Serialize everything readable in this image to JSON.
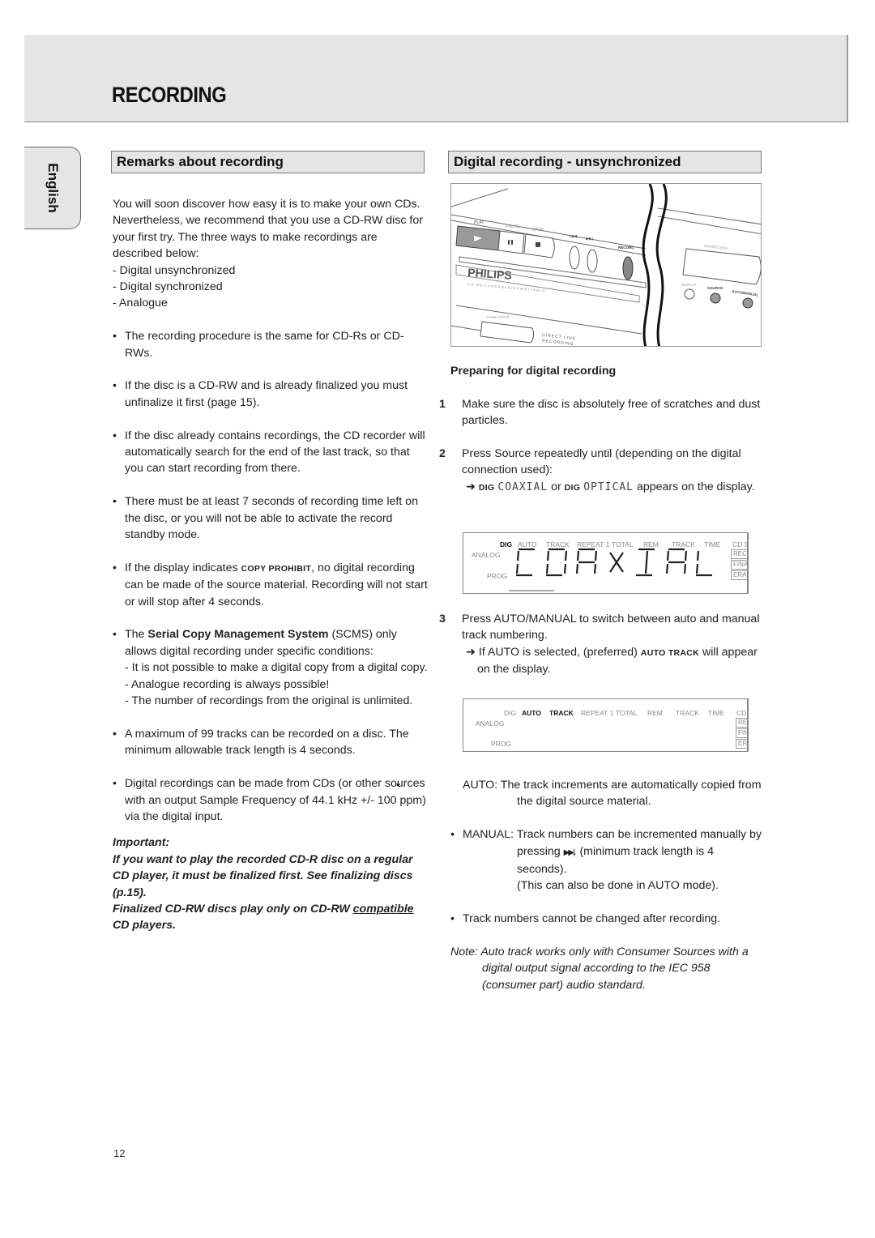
{
  "header": {
    "title": "RECORDING"
  },
  "language_tab": {
    "label": "English"
  },
  "left": {
    "heading": "Remarks about recording",
    "intro": "You will soon discover how easy it is to make your own CDs. Nevertheless, we recommend that you use a CD-RW disc for your first try. The three ways to make recordings are described below:",
    "ways": [
      "- Digital unsynchronized",
      "- Digital synchronized",
      "- Analogue"
    ],
    "bullets": {
      "b1": "The recording procedure is the same for CD-Rs or CD-RWs.",
      "b2": "If the disc is a CD-RW and is already finalized you must unfinalize it first (page 15).",
      "b3": "If the disc already contains recordings, the CD recorder will automatically search for the end of the last track, so that you can start recording from there.",
      "b4": "There must be at least 7 seconds of recording time left on the disc, or you will not be able to activate the record standby mode.",
      "b5_pre": "If the display indicates ",
      "b5_code": "COPY PROHIBIT",
      "b5_post": ", no digital recording can be made of the source material. Recording will not start or will stop after 4 seconds.",
      "b6_pre": "The ",
      "b6_bold": "Serial Copy Management System",
      "b6_post": " (SCMS) only allows digital recording under specific conditions:",
      "b6_subs": [
        "- It is not possible to make a digital copy from a digital copy.",
        "- Analogue recording is always possible!",
        "- The number of recordings from the original is unlimited."
      ],
      "b7": "A maximum of 99 tracks can be recorded on a disc. The minimum allowable track length is 4 seconds.",
      "b8": "Digital recordings can be made from CDs (or other sources with an output Sample Frequency of 44.1 kHz +/- 100 ppm) via the digital input."
    },
    "important": {
      "label": "Important:",
      "text1": "If you want to play the recorded CD-R disc on a regular CD player, it must be finalized first. See finalizing discs (p.15).",
      "text2_pre": "Finalized CD-RW discs play only on CD-RW ",
      "text2_underline": "compatible",
      "text2_post": " CD players."
    }
  },
  "right": {
    "heading": "Digital recording - unsynchronized",
    "device": {
      "brand": "PHILIPS",
      "subtitle": "CD-RECORDABLE/REWRITABLE",
      "buttons": {
        "play": "PLAY",
        "pause": "PAUSE",
        "stop": "STOP",
        "prev": "|◀◀",
        "next": "▶▶|",
        "record": "RECORD",
        "open_close": "OPEN/CLOSE",
        "display": "DISPLAY",
        "source": "SOURCE",
        "auto_manual": "AUTO/MANUAL",
        "power": "Power On/Off"
      },
      "direct_line_1": "DIRECT LINE",
      "direct_line_2": "RECORDING"
    },
    "sub_heading": "Preparing for digital recording",
    "step1_num": "1",
    "step1": "Make sure the disc is absolutely free of scratches and dust particles.",
    "step2_num": "2",
    "step2": "Press Source repeatedly until (depending on the digital connection used):",
    "step2_arrow": "➜",
    "step2_dig1": "DIG",
    "step2_lcd1": "COAXIAL",
    "step2_or": " or ",
    "step2_dig2": "DIG",
    "step2_lcd2": "OPTICAL",
    "step2_post": " appears on the display.",
    "display1": {
      "labels": {
        "dig": "DIG",
        "auto": "AUTO",
        "track": "TRACK",
        "repeat": "REPEAT 1",
        "total": "TOTAL",
        "rem": "REM",
        "track2": "TRACK",
        "time": "TIME",
        "cd": "CD S",
        "analog": "ANALOG",
        "prog": "PROG",
        "rec": "RECO",
        "fina": "FINA",
        "era": "ERA"
      },
      "segments": "COAXIAL"
    },
    "step3_num": "3",
    "step3": "Press AUTO/MANUAL to switch between auto and manual track numbering.",
    "step3_arrow": "➜",
    "step3_pre": " If AUTO is selected, (preferred) ",
    "step3_code": "AUTO TRACK",
    "step3_post": " will appear on the display.",
    "display2": {
      "labels": {
        "dig": "DIG",
        "auto": "AUTO",
        "track": "TRACK",
        "repeat": "REPEAT 1",
        "total": "TOTAL",
        "rem": "REM",
        "track2": "TRACK",
        "time": "TIME",
        "cd": "CD S",
        "analog": "ANALOG",
        "prog": "PROG",
        "rec": "REC",
        "fina": "FINA",
        "era": "ER"
      }
    },
    "auto_label": "AUTO:",
    "auto_text": "The track increments are automatically copied from the digital source material.",
    "manual_label": "MANUAL:",
    "manual_text1": "Track numbers can be incremented manually by",
    "manual_text2_pre": "pressing ",
    "manual_icon": "▶▶|",
    "manual_text2_post": ". (minimum track length is 4 seconds).",
    "manual_text3": "(This can also be done in AUTO mode).",
    "track_note": "Track numbers cannot be changed after recording.",
    "note": "Note: Auto track works only with Consumer Sources with a digital output signal according to the IEC 958 (consumer part) audio standard."
  },
  "footer": {
    "page_number": "12"
  }
}
